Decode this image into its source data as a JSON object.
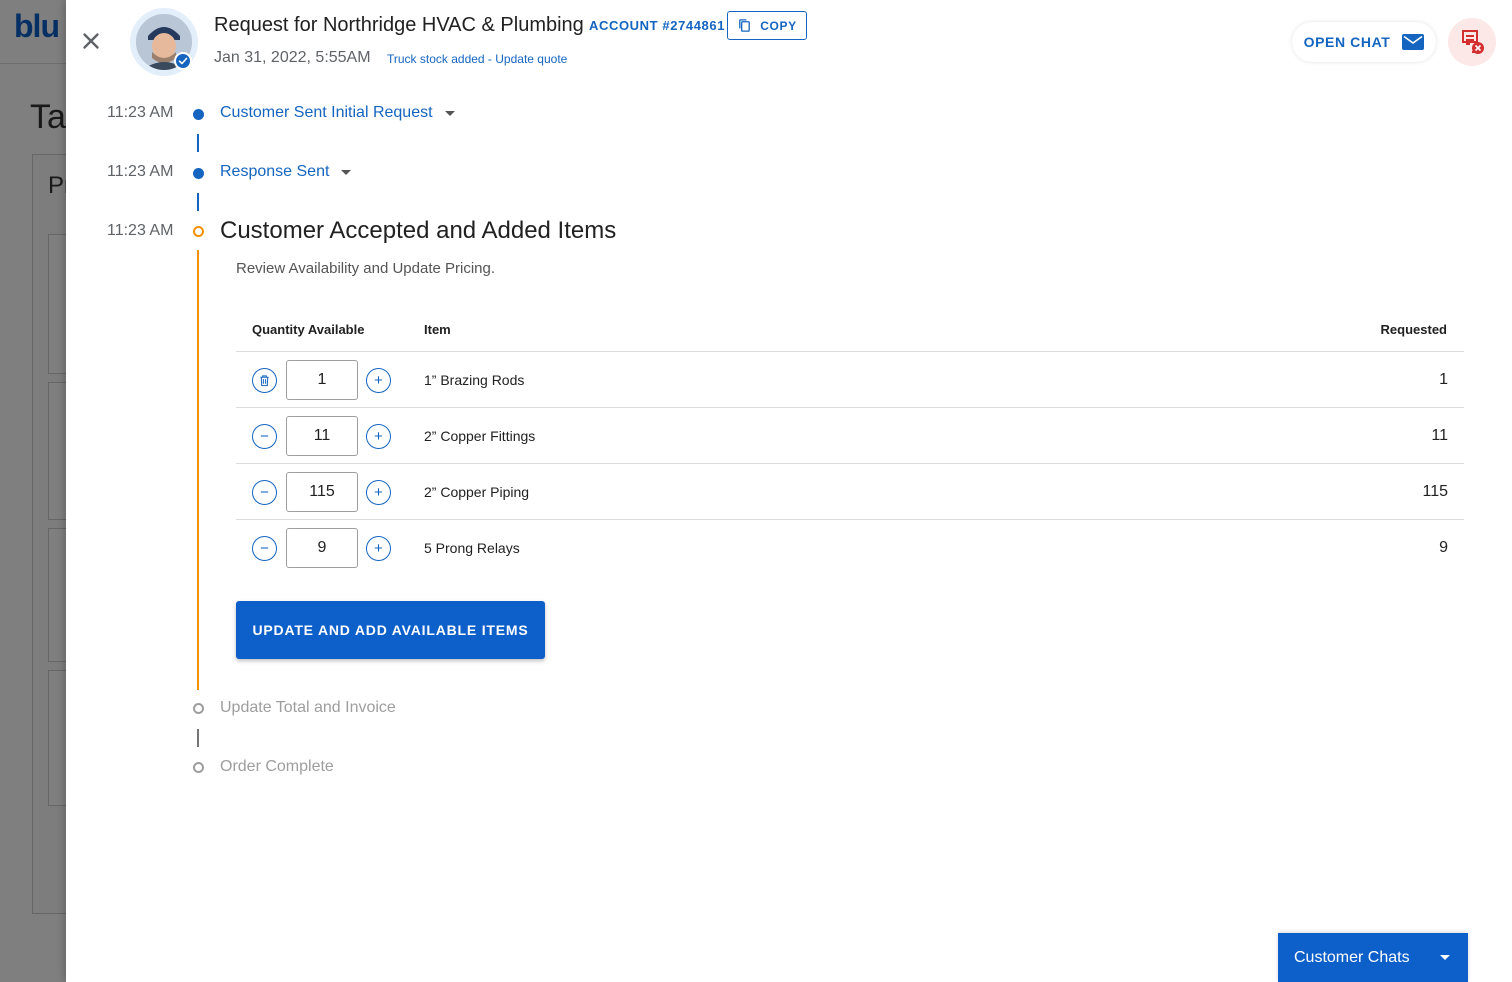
{
  "background_app": {
    "logo_text": "blu",
    "heading": "Ta",
    "panel_title": "Pr"
  },
  "header": {
    "title": "Request for Northridge HVAC & Plumbing",
    "account": "ACCOUNT #2744861",
    "copy_label": "COPY",
    "date": "Jan 31, 2022, 5:55AM",
    "status_link": "Truck stock added - Update quote",
    "open_chat_label": "OPEN CHAT"
  },
  "timeline": {
    "steps": [
      {
        "time": "11:23 AM",
        "label": "Customer Sent Initial Request",
        "state": "done"
      },
      {
        "time": "11:23 AM",
        "label": "Response Sent",
        "state": "done"
      },
      {
        "time": "11:23 AM",
        "label": "Customer Accepted and Added Items",
        "state": "active"
      },
      {
        "time": "",
        "label": "Update Total and Invoice",
        "state": "pending"
      },
      {
        "time": "",
        "label": "Order Complete",
        "state": "pending"
      }
    ],
    "active_subtitle": "Review Availability and Update Pricing."
  },
  "items_table": {
    "headers": {
      "quantity": "Quantity Available",
      "item": "Item",
      "requested": "Requested"
    },
    "rows": [
      {
        "quantity": "1",
        "item": "1” Brazing Rods",
        "requested": "1"
      },
      {
        "quantity": "11",
        "item": "2” Copper Fittings",
        "requested": "11"
      },
      {
        "quantity": "115",
        "item": "2” Copper Piping",
        "requested": "115"
      },
      {
        "quantity": "9",
        "item": "5 Prong Relays",
        "requested": "9"
      }
    ]
  },
  "primary_action": "UPDATE AND ADD AVAILABLE ITEMS",
  "customer_chats_label": "Customer Chats",
  "colors": {
    "primary": "#0d5fc9",
    "link": "#1565c0",
    "active_step": "#f39200",
    "alert": "#d32f2f"
  },
  "icons": {
    "close": "close-icon",
    "copy": "copy-icon",
    "mail": "mail-icon",
    "alert": "remove-document-icon",
    "trash": "trash-icon",
    "minus": "minus-icon",
    "plus": "plus-icon"
  }
}
